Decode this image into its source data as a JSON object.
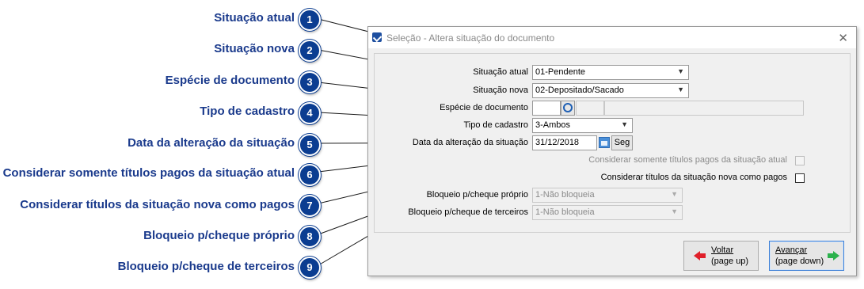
{
  "callouts": [
    {
      "num": "1",
      "label": "Situação atual"
    },
    {
      "num": "2",
      "label": "Situação nova"
    },
    {
      "num": "3",
      "label": "Espécie de documento"
    },
    {
      "num": "4",
      "label": "Tipo de cadastro"
    },
    {
      "num": "5",
      "label": "Data da alteração da situação"
    },
    {
      "num": "6",
      "label": "Considerar somente títulos pagos da situação atual"
    },
    {
      "num": "7",
      "label": "Considerar títulos da situação nova como pagos"
    },
    {
      "num": "8",
      "label": "Bloqueio p/cheque próprio"
    },
    {
      "num": "9",
      "label": "Bloqueio p/cheque de terceiros"
    }
  ],
  "window": {
    "title": "Seleção - Altera situação do documento",
    "close_icon": "close-icon"
  },
  "form": {
    "situacao_atual": {
      "label": "Situação atual",
      "value": "01-Pendente"
    },
    "situacao_nova": {
      "label": "Situação nova",
      "value": "02-Depositado/Sacado"
    },
    "especie": {
      "label": "Espécie de documento",
      "code": "",
      "description": ""
    },
    "tipo_cadastro": {
      "label": "Tipo de cadastro",
      "value": "3-Ambos"
    },
    "data_alteracao": {
      "label": "Data da alteração da situação",
      "value": "31/12/2018",
      "weekday": "Seg"
    },
    "somente_pagos": {
      "label": "Considerar somente títulos pagos da situação atual",
      "checked": false,
      "enabled": false
    },
    "titulos_nova_pagos": {
      "label": "Considerar títulos da situação nova como pagos",
      "checked": false,
      "enabled": true
    },
    "bloqueio_proprio": {
      "label": "Bloqueio p/cheque próprio",
      "value": "1-Não bloqueia",
      "enabled": false
    },
    "bloqueio_terceiros": {
      "label": "Bloqueio p/cheque de terceiros",
      "value": "1-Não bloqueia",
      "enabled": false
    }
  },
  "buttons": {
    "voltar": {
      "line1": "Voltar",
      "line2": "(page up)"
    },
    "avancar": {
      "line1": "Avançar",
      "line2": "(page down)"
    }
  },
  "colors": {
    "callout_text": "#1a3a8c",
    "badge": "#0b3d91",
    "arrow_back": "#e0202a",
    "arrow_fwd": "#2bb24c"
  }
}
